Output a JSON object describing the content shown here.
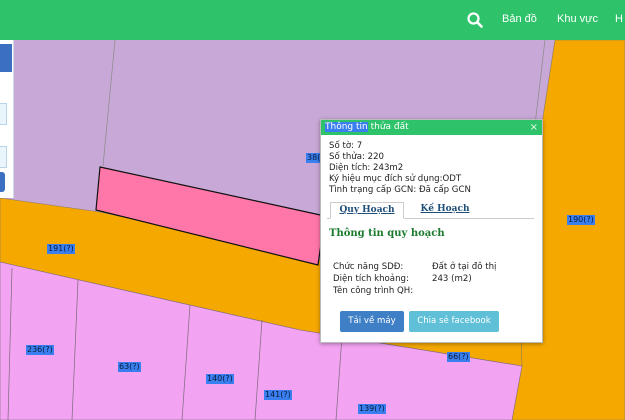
{
  "nav": {
    "items": [
      "Bản đồ",
      "Khu vực",
      "H"
    ]
  },
  "map": {
    "parcel_labels": [
      "38(",
      "191(?)",
      "190(?)",
      "236(?)",
      "63(?)",
      "140(?)",
      "141(?)",
      "139(?)",
      "66(?)"
    ]
  },
  "popup": {
    "title_highlight": "Thông tin",
    "title_rest": " thửa đất",
    "close": "×",
    "info": [
      "Số tờ: 7",
      "Số thửa: 220",
      "Diện tích: 243m2",
      "Ký hiệu mục đích sử dụng:ODT",
      "Tình trạng cấp GCN: Đã cấp GCN"
    ],
    "tabs": [
      "Quy Hoạch",
      "Kế Hoạch"
    ],
    "section_title": "Thông tin quy hoạch",
    "rows": [
      {
        "k": "Chức năng SDĐ:",
        "v": "Đất ở tại đô thị"
      },
      {
        "k": "Diện tích khoảng:",
        "v": "243 (m2)"
      },
      {
        "k": "Tên công trình QH:",
        "v": ""
      }
    ],
    "download_label": "Tải về máy",
    "facebook_label": "Chia sẻ facebook"
  },
  "colors": {
    "nav": "#2ec36a",
    "road": "#f5a800",
    "residential": "#c8a8d6",
    "selected_parcel": "#ff77a8",
    "pink_block": "#f2a3f2"
  }
}
